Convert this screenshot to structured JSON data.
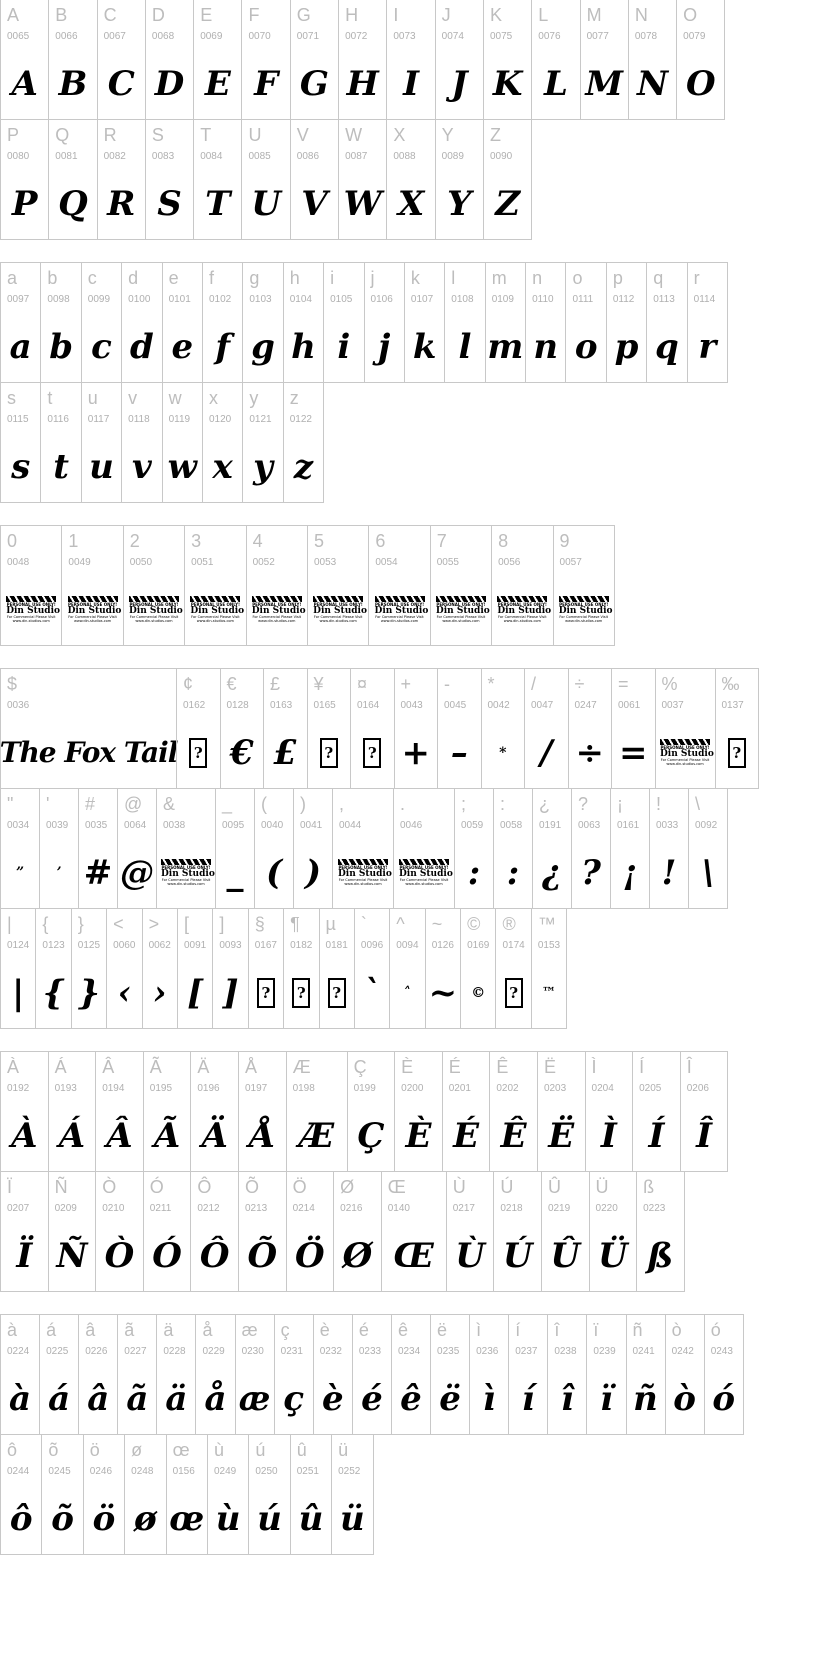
{
  "watermark": {
    "line1": "PERSONAL USE ONLY!",
    "line2": "Din Studio",
    "line3": "For Commercial Please Visit",
    "line4": "www.din-studios.com"
  },
  "missing_glyph": "?",
  "blocks": [
    {
      "rows": [
        [
          [
            "A",
            "0065"
          ],
          [
            "B",
            "0066"
          ],
          [
            "C",
            "0067"
          ],
          [
            "D",
            "0068"
          ],
          [
            "E",
            "0069"
          ],
          [
            "F",
            "0070"
          ],
          [
            "G",
            "0071"
          ],
          [
            "H",
            "0072"
          ],
          [
            "I",
            "0073"
          ],
          [
            "J",
            "0074"
          ],
          [
            "K",
            "0075"
          ],
          [
            "L",
            "0076"
          ],
          [
            "M",
            "0077"
          ],
          [
            "N",
            "0078"
          ],
          [
            "O",
            "0079"
          ]
        ],
        [
          [
            "P",
            "0080"
          ],
          [
            "Q",
            "0081"
          ],
          [
            "R",
            "0082"
          ],
          [
            "S",
            "0083"
          ],
          [
            "T",
            "0084"
          ],
          [
            "U",
            "0085"
          ],
          [
            "V",
            "0086"
          ],
          [
            "W",
            "0087"
          ],
          [
            "X",
            "0088"
          ],
          [
            "Y",
            "0089"
          ],
          [
            "Z",
            "0090"
          ]
        ]
      ]
    },
    {
      "rows": [
        [
          [
            "a",
            "0097"
          ],
          [
            "b",
            "0098"
          ],
          [
            "c",
            "0099"
          ],
          [
            "d",
            "0100"
          ],
          [
            "e",
            "0101"
          ],
          [
            "f",
            "0102"
          ],
          [
            "g",
            "0103"
          ],
          [
            "h",
            "0104"
          ],
          [
            "i",
            "0105"
          ],
          [
            "j",
            "0106"
          ],
          [
            "k",
            "0107"
          ],
          [
            "l",
            "0108"
          ],
          [
            "m",
            "0109"
          ],
          [
            "n",
            "0110"
          ],
          [
            "o",
            "0111"
          ],
          [
            "p",
            "0112"
          ],
          [
            "q",
            "0113"
          ],
          [
            "r",
            "0114"
          ]
        ],
        [
          [
            "s",
            "0115"
          ],
          [
            "t",
            "0116"
          ],
          [
            "u",
            "0117"
          ],
          [
            "v",
            "0118"
          ],
          [
            "w",
            "0119"
          ],
          [
            "x",
            "0120"
          ],
          [
            "y",
            "0121"
          ],
          [
            "z",
            "0122"
          ]
        ]
      ]
    },
    {
      "rows": [
        [
          [
            "0",
            "0048",
            "watermark"
          ],
          [
            "1",
            "0049",
            "watermark"
          ],
          [
            "2",
            "0050",
            "watermark"
          ],
          [
            "3",
            "0051",
            "watermark"
          ],
          [
            "4",
            "0052",
            "watermark"
          ],
          [
            "5",
            "0053",
            "watermark"
          ],
          [
            "6",
            "0054",
            "watermark"
          ],
          [
            "7",
            "0055",
            "watermark"
          ],
          [
            "8",
            "0056",
            "watermark"
          ],
          [
            "9",
            "0057",
            "watermark"
          ]
        ]
      ]
    },
    {
      "rows": [
        [
          [
            "$",
            "0036",
            "title",
            "The Fox Tail"
          ],
          [
            "¢",
            "0162",
            "missing"
          ],
          [
            "€",
            "0128"
          ],
          [
            "£",
            "0163"
          ],
          [
            "¥",
            "0165",
            "missing"
          ],
          [
            "¤",
            "0164",
            "missing"
          ],
          [
            "+",
            "0043"
          ],
          [
            "-",
            "0045",
            "glyph",
            "–"
          ],
          [
            "*",
            "0042",
            "small"
          ],
          [
            "/",
            "0047"
          ],
          [
            "÷",
            "0247"
          ],
          [
            "=",
            "0061"
          ],
          [
            "%",
            "0037",
            "watermark"
          ],
          [
            "‰",
            "0137",
            "missing"
          ]
        ],
        [
          [
            "\"",
            "0034",
            "small",
            "”"
          ],
          [
            "'",
            "0039",
            "small",
            "’"
          ],
          [
            "#",
            "0035"
          ],
          [
            "@",
            "0064"
          ],
          [
            "&",
            "0038",
            "watermark"
          ],
          [
            "_",
            "0095"
          ],
          [
            "(",
            "0040"
          ],
          [
            ")",
            "0041"
          ],
          [
            ",",
            "0044",
            "watermark"
          ],
          [
            ".",
            "0046",
            "watermark"
          ],
          [
            ";",
            "0059",
            "glyph",
            ":"
          ],
          [
            ":",
            "0058"
          ],
          [
            "¿",
            "0191"
          ],
          [
            "?",
            "0063"
          ],
          [
            "¡",
            "0161"
          ],
          [
            "!",
            "0033"
          ],
          [
            "\\",
            "0092"
          ]
        ],
        [
          [
            "|",
            "0124"
          ],
          [
            "{",
            "0123"
          ],
          [
            "}",
            "0125"
          ],
          [
            "<",
            "0060",
            "glyph",
            "‹"
          ],
          [
            ">",
            "0062",
            "glyph",
            "›"
          ],
          [
            "[",
            "0091"
          ],
          [
            "]",
            "0093"
          ],
          [
            "§",
            "0167",
            "missing"
          ],
          [
            "¶",
            "0182",
            "missing"
          ],
          [
            "µ",
            "0181",
            "missing"
          ],
          [
            "`",
            "0096"
          ],
          [
            "^",
            "0094",
            "small",
            "˄"
          ],
          [
            "~",
            "0126"
          ],
          [
            "©",
            "0169",
            "small"
          ],
          [
            "®",
            "0174",
            "missing"
          ],
          [
            "™",
            "0153",
            "small"
          ]
        ]
      ]
    },
    {
      "rows": [
        [
          [
            "À",
            "0192"
          ],
          [
            "Á",
            "0193"
          ],
          [
            "Â",
            "0194"
          ],
          [
            "Ã",
            "0195"
          ],
          [
            "Ä",
            "0196"
          ],
          [
            "Å",
            "0197"
          ],
          [
            "Æ",
            "0198"
          ],
          [
            "Ç",
            "0199"
          ],
          [
            "È",
            "0200"
          ],
          [
            "É",
            "0201"
          ],
          [
            "Ê",
            "0202"
          ],
          [
            "Ë",
            "0203"
          ],
          [
            "Ì",
            "0204"
          ],
          [
            "Í",
            "0205"
          ],
          [
            "Î",
            "0206"
          ]
        ],
        [
          [
            "Ï",
            "0207"
          ],
          [
            "Ñ",
            "0209"
          ],
          [
            "Ò",
            "0210"
          ],
          [
            "Ó",
            "0211"
          ],
          [
            "Ô",
            "0212"
          ],
          [
            "Õ",
            "0213"
          ],
          [
            "Ö",
            "0214"
          ],
          [
            "Ø",
            "0216"
          ],
          [
            "Œ",
            "0140"
          ],
          [
            "Ù",
            "0217"
          ],
          [
            "Ú",
            "0218"
          ],
          [
            "Û",
            "0219"
          ],
          [
            "Ü",
            "0220"
          ],
          [
            "ß",
            "0223"
          ]
        ]
      ]
    },
    {
      "rows": [
        [
          [
            "à",
            "0224"
          ],
          [
            "á",
            "0225"
          ],
          [
            "â",
            "0226"
          ],
          [
            "ã",
            "0227"
          ],
          [
            "ä",
            "0228"
          ],
          [
            "å",
            "0229"
          ],
          [
            "æ",
            "0230"
          ],
          [
            "ç",
            "0231"
          ],
          [
            "è",
            "0232"
          ],
          [
            "é",
            "0233"
          ],
          [
            "ê",
            "0234"
          ],
          [
            "ë",
            "0235"
          ],
          [
            "ì",
            "0236"
          ],
          [
            "í",
            "0237"
          ],
          [
            "î",
            "0238"
          ],
          [
            "ï",
            "0239"
          ],
          [
            "ñ",
            "0241"
          ],
          [
            "ò",
            "0242"
          ],
          [
            "ó",
            "0243"
          ]
        ],
        [
          [
            "ô",
            "0244"
          ],
          [
            "õ",
            "0245"
          ],
          [
            "ö",
            "0246"
          ],
          [
            "ø",
            "0248"
          ],
          [
            "œ",
            "0156"
          ],
          [
            "ù",
            "0249"
          ],
          [
            "ú",
            "0250"
          ],
          [
            "û",
            "0251"
          ],
          [
            "ü",
            "0252"
          ]
        ]
      ]
    }
  ]
}
